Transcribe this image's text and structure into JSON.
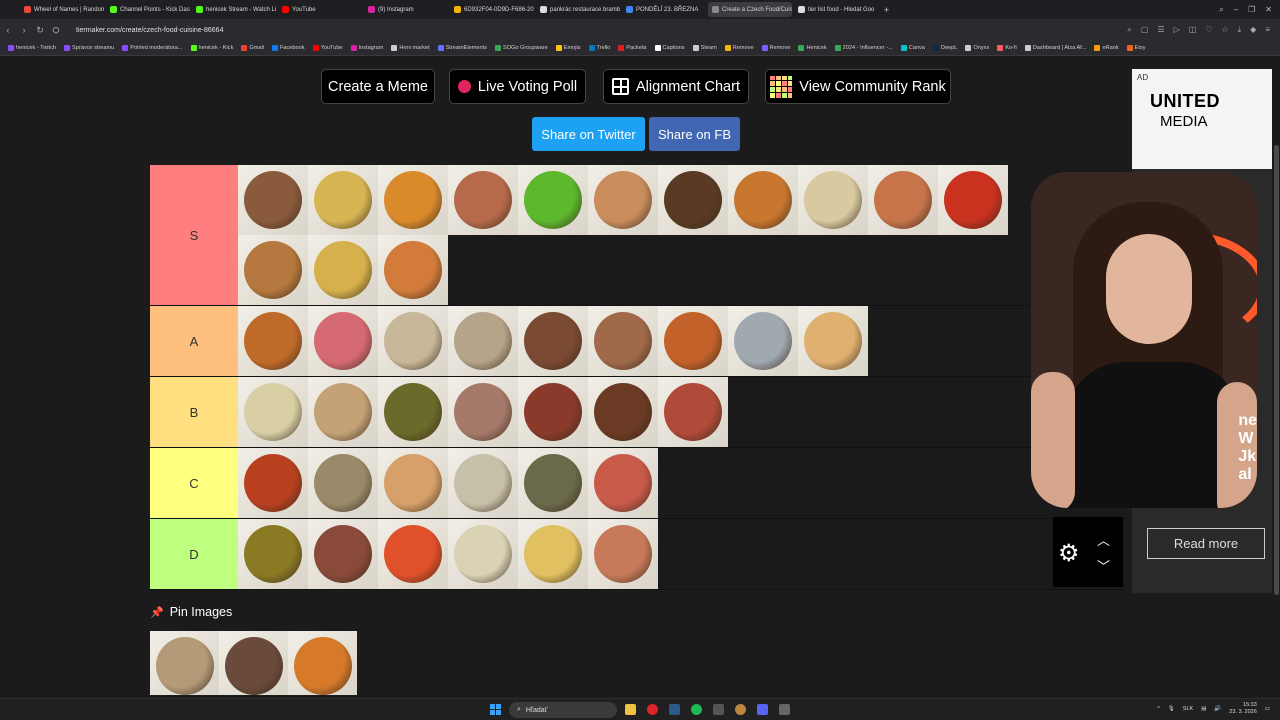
{
  "browser": {
    "tabs": [
      {
        "label": "Wheel of Names | Random",
        "color": "#e8473a"
      },
      {
        "label": "Channel Points - Kick Das",
        "color": "#53fc18"
      },
      {
        "label": "henicek Stream - Watch Li",
        "color": "#53fc18"
      },
      {
        "label": "YouTube",
        "color": "#ff0000"
      },
      {
        "label": "(9) Instagram",
        "color": "#d6249f"
      },
      {
        "label": "6D932F04-0D9D-F686-20",
        "color": "#f5b400"
      },
      {
        "label": "pankrác restaurace brambo",
        "color": "#dddddd"
      },
      {
        "label": "PONDĚLÍ 23. BŘEZNA",
        "color": "#4285f4"
      },
      {
        "label": "Create a Czech Food/Cuis",
        "color": "#888888",
        "active": true
      },
      {
        "label": "tier list food - Hledat Goo",
        "color": "#dddddd"
      }
    ],
    "new_tab": "+",
    "url": "tiermaker.com/create/czech-food-cuisine-86664",
    "bookmarks": [
      {
        "label": "henicek - Twitch",
        "color": "#9146ff"
      },
      {
        "label": "Správce streamu",
        "color": "#9146ff"
      },
      {
        "label": "Pohled moderátora...",
        "color": "#9146ff"
      },
      {
        "label": "henicek - Kick",
        "color": "#53fc18"
      },
      {
        "label": "Gmail",
        "color": "#ea4335"
      },
      {
        "label": "Facebook",
        "color": "#1877f2"
      },
      {
        "label": "YouTube",
        "color": "#ff0000"
      },
      {
        "label": "Instagram",
        "color": "#d6249f"
      },
      {
        "label": "Heni market",
        "color": "#cccccc"
      },
      {
        "label": "StreamElements",
        "color": "#6b6bff"
      },
      {
        "label": "SOGo Groupware",
        "color": "#33aa55"
      },
      {
        "label": "Emojis",
        "color": "#f5c518"
      },
      {
        "label": "Trello",
        "color": "#0079bf"
      },
      {
        "label": "Packeta",
        "color": "#e31d1a"
      },
      {
        "label": "Captions",
        "color": "#ffffff"
      },
      {
        "label": "Steam",
        "color": "#cccccc"
      },
      {
        "label": "Remove",
        "color": "#f5b400"
      },
      {
        "label": "Remove",
        "color": "#7a5cff"
      },
      {
        "label": "Henicek",
        "color": "#33aa55"
      },
      {
        "label": "2024 - Influencer -...",
        "color": "#33aa55"
      },
      {
        "label": "Canva",
        "color": "#00c4cc"
      },
      {
        "label": "DeepL",
        "color": "#0f2b46"
      },
      {
        "label": "Onyxx",
        "color": "#cccccc"
      },
      {
        "label": "Ko-fi",
        "color": "#ff5e5b"
      },
      {
        "label": "Dashboard | Alza Af...",
        "color": "#cccccc"
      },
      {
        "label": "eRank",
        "color": "#f59e0b"
      },
      {
        "label": "Etsy",
        "color": "#f1641e"
      }
    ]
  },
  "toolbar": {
    "create_meme": "Create a Meme",
    "live_poll": "Live Voting Poll",
    "alignment_chart": "Alignment Chart",
    "community_rank": "View Community Rank"
  },
  "share": {
    "twitter": "Share on Twitter",
    "facebook": "Share on FB",
    "twitter_color": "#1da1f2",
    "facebook_color": "#4267b2"
  },
  "tiers": [
    {
      "label": "S",
      "color": "#ff7f7f",
      "rows": 2,
      "items": [
        "#8a5a3c",
        "#d8b553",
        "#d98a2b",
        "#b76a4a",
        "#5db82d",
        "#c98d5d",
        "#5a3a24",
        "#c9772f",
        "#d9c9a0",
        "#c7744a",
        "#c8321f",
        "#b5783e",
        "#d5b04b",
        "#d27b3a"
      ]
    },
    {
      "label": "A",
      "color": "#ffbf7f",
      "rows": 1,
      "items": [
        "#c06a2a",
        "#d66a72",
        "#c9b79a",
        "#b5a48a",
        "#7a4a32",
        "#a06a4a",
        "#c2622a",
        "#a0a8b0",
        "#e0b070"
      ]
    },
    {
      "label": "B",
      "color": "#ffdf7f",
      "rows": 1,
      "items": [
        "#d8cfa5",
        "#c4a276",
        "#6a6a2a",
        "#a67a6a",
        "#8a3a2a",
        "#6a3a24",
        "#b04a3a"
      ]
    },
    {
      "label": "C",
      "color": "#ffff7f",
      "rows": 1,
      "items": [
        "#b8401f",
        "#9a8a6a",
        "#d7a06a",
        "#c7c0a8",
        "#6a6a4a",
        "#c85a4a"
      ]
    },
    {
      "label": "D",
      "color": "#bfff7f",
      "rows": 1,
      "items": [
        "#8a7a24",
        "#8a4a3a",
        "#e0502a",
        "#d9d2b5",
        "#e0c060",
        "#c77a5a"
      ]
    }
  ],
  "pins": {
    "title": "Pin Images",
    "items": [
      "#b59a78",
      "#6a4a3a",
      "#d67a2a"
    ]
  },
  "ad": {
    "tag": "AD",
    "brand_line1": "UNITED",
    "brand_line2": "MEDIA",
    "read_more": "Read more"
  },
  "webcam": {
    "text": "ne\nW\nJk\nal"
  },
  "taskbar": {
    "search": "Hľadať",
    "lang": "SLK",
    "time": "15:33",
    "date": "23. 3. 2026"
  }
}
